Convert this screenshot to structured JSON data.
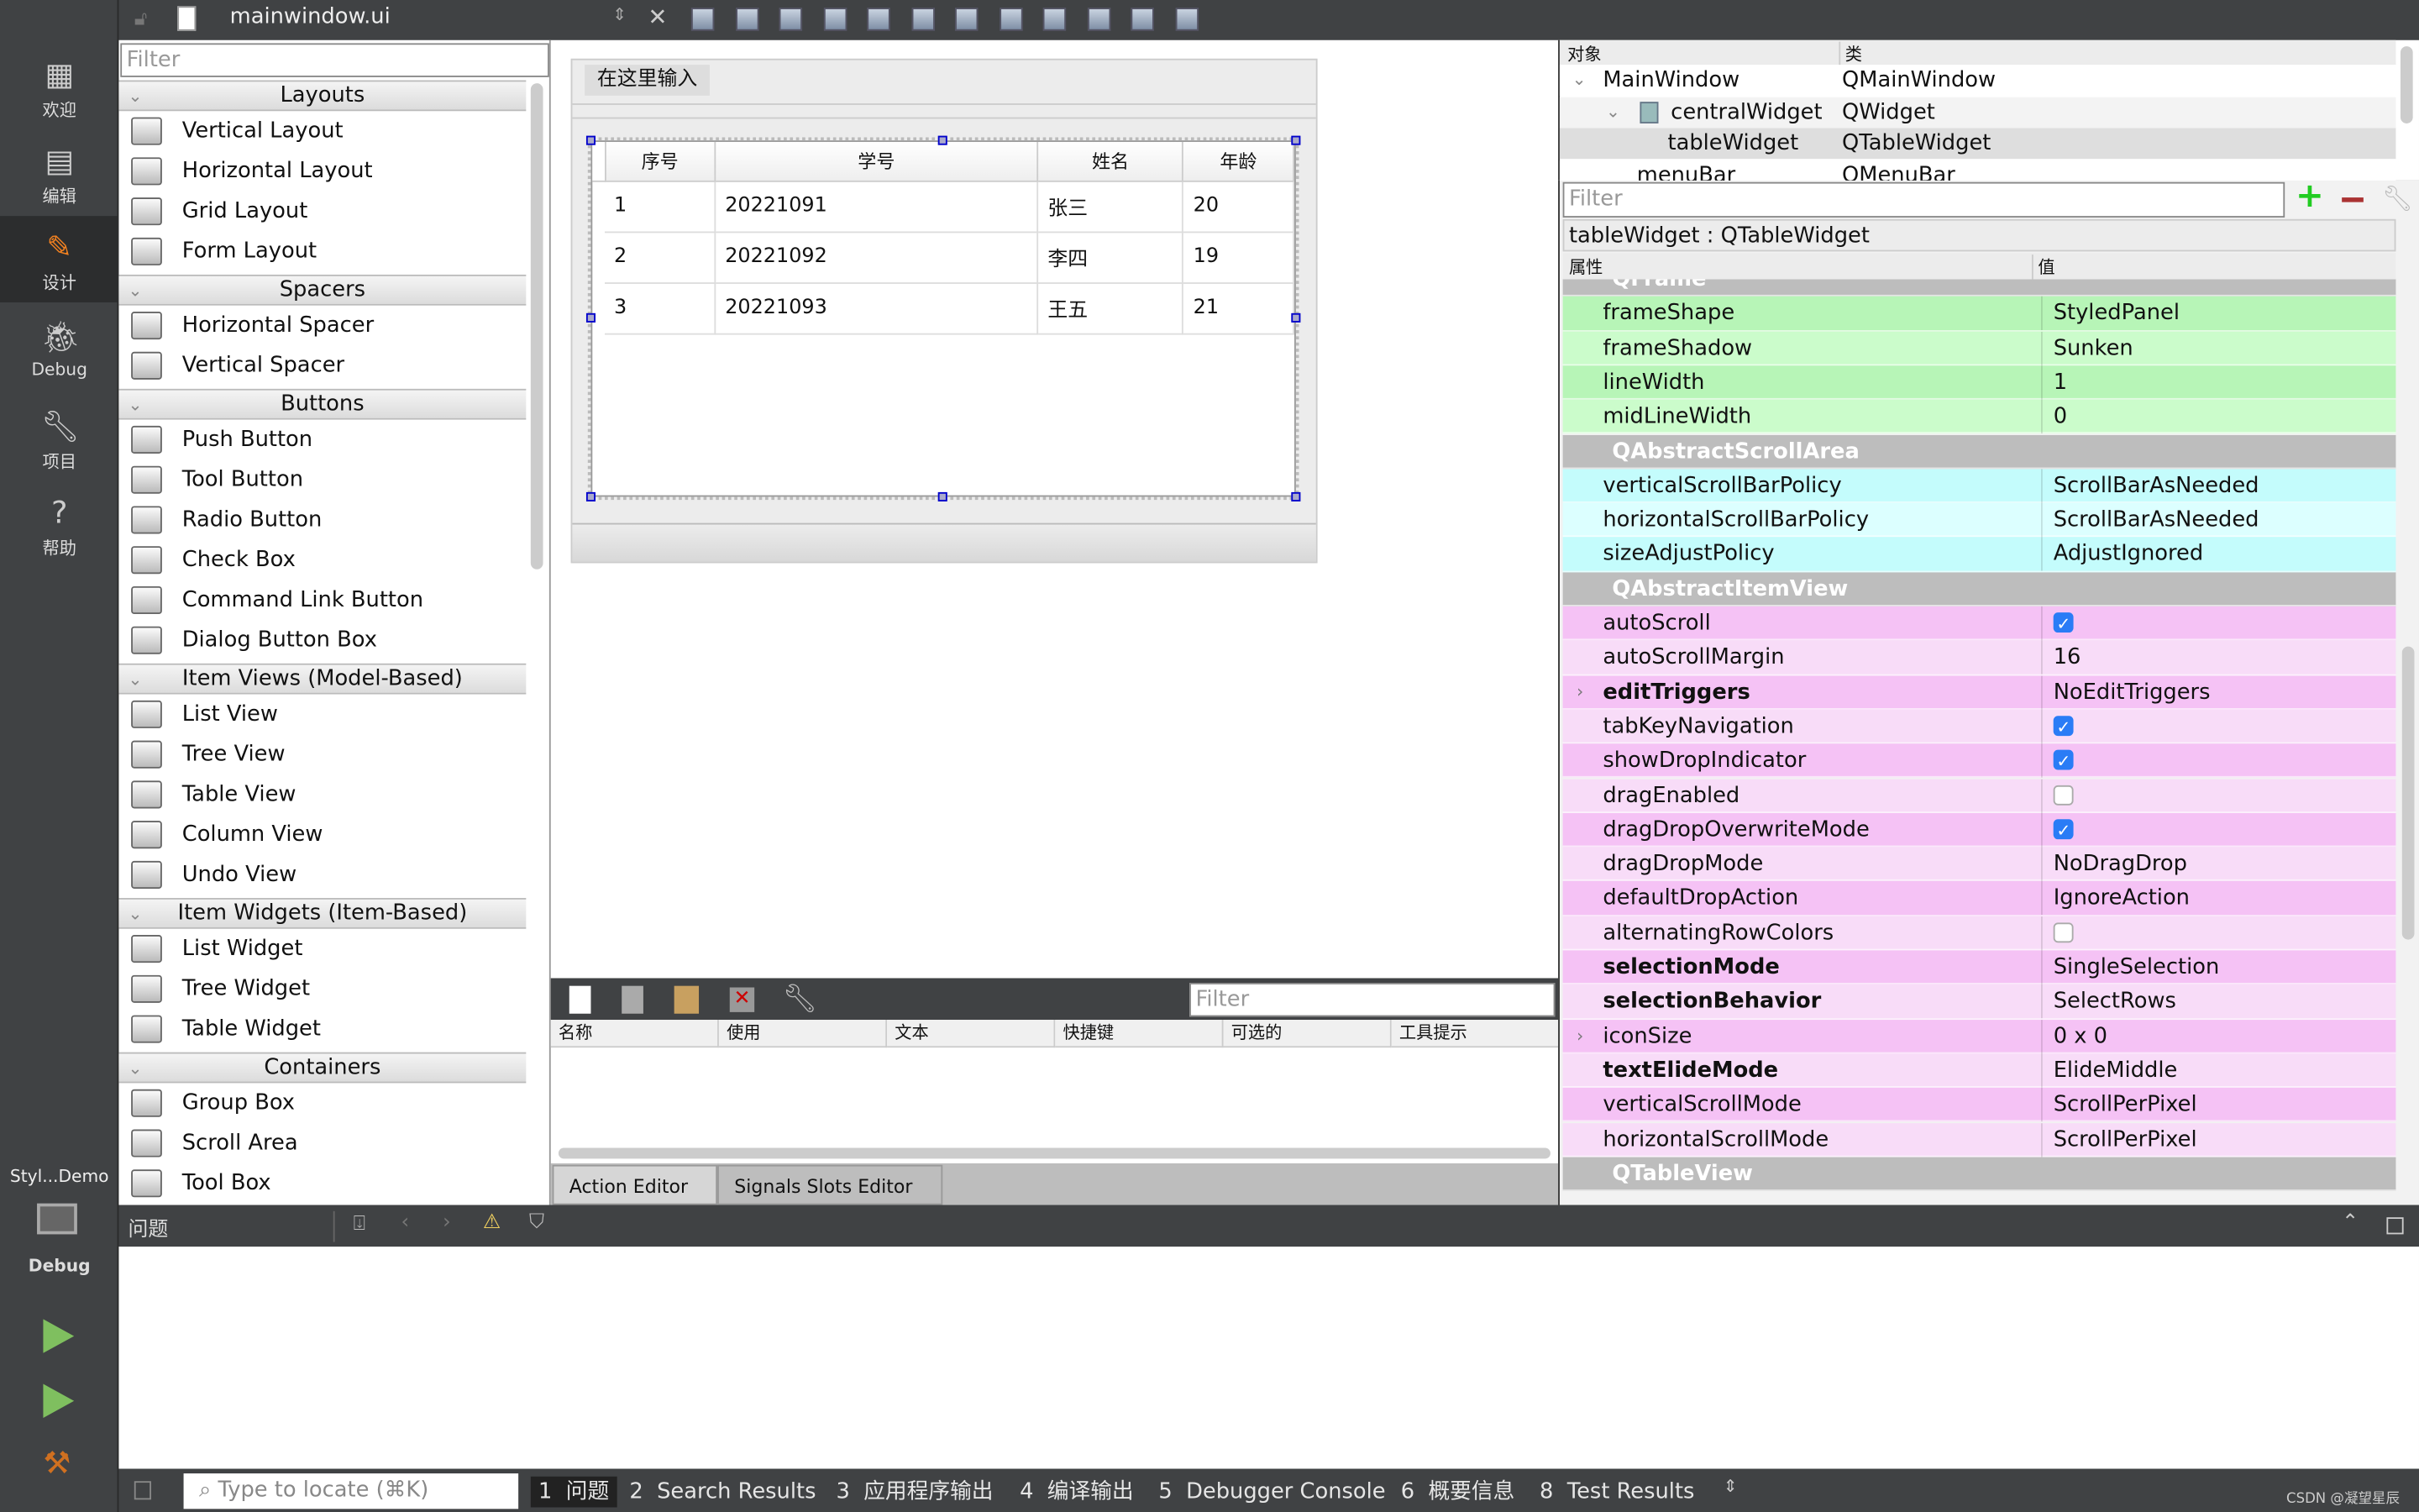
{
  "modebar": {
    "items": [
      {
        "label": "欢迎",
        "icon": "grid-icon"
      },
      {
        "label": "编辑",
        "icon": "document-icon"
      },
      {
        "label": "设计",
        "icon": "pencil-icon",
        "active": true
      },
      {
        "label": "Debug",
        "icon": "bug-icon"
      },
      {
        "label": "项目",
        "icon": "wrench-icon"
      },
      {
        "label": "帮助",
        "icon": "help-icon"
      }
    ],
    "project": "Styl...Demo",
    "kit_label": "Debug"
  },
  "topbar": {
    "filename": "mainwindow.ui"
  },
  "widgetbox": {
    "filter_placeholder": "Filter",
    "sections": [
      {
        "title": "Layouts",
        "items": [
          "Vertical Layout",
          "Horizontal Layout",
          "Grid Layout",
          "Form Layout"
        ]
      },
      {
        "title": "Spacers",
        "items": [
          "Horizontal Spacer",
          "Vertical Spacer"
        ]
      },
      {
        "title": "Buttons",
        "items": [
          "Push Button",
          "Tool Button",
          "Radio Button",
          "Check Box",
          "Command Link Button",
          "Dialog Button Box"
        ]
      },
      {
        "title": "Item Views (Model-Based)",
        "items": [
          "List View",
          "Tree View",
          "Table View",
          "Column View",
          "Undo View"
        ]
      },
      {
        "title": "Item Widgets (Item-Based)",
        "items": [
          "List Widget",
          "Tree Widget",
          "Table Widget"
        ]
      },
      {
        "title": "Containers",
        "items": [
          "Group Box",
          "Scroll Area",
          "Tool Box"
        ]
      }
    ]
  },
  "form": {
    "menu_placeholder": "在这里输入",
    "table": {
      "headers": [
        "序号",
        "学号",
        "姓名",
        "年龄"
      ],
      "rows": [
        [
          "1",
          "20221091",
          "张三",
          "20"
        ],
        [
          "2",
          "20221092",
          "李四",
          "19"
        ],
        [
          "3",
          "20221093",
          "王五",
          "21"
        ]
      ]
    }
  },
  "action_editor": {
    "filter_placeholder": "Filter",
    "columns": [
      "名称",
      "使用",
      "文本",
      "快捷键",
      "可选的",
      "工具提示"
    ],
    "tabs": [
      "Action Editor",
      "Signals  Slots Editor"
    ]
  },
  "object_inspector": {
    "headers": [
      "对象",
      "类"
    ],
    "rows": [
      [
        "MainWindow",
        "QMainWindow"
      ],
      [
        "centralWidget",
        "QWidget"
      ],
      [
        "tableWidget",
        "QTableWidget"
      ],
      [
        "menuBar",
        "QMenuBar"
      ]
    ]
  },
  "property_editor": {
    "filter_placeholder": "Filter",
    "object_label": "tableWidget : QTableWidget",
    "headers": [
      "属性",
      "值"
    ],
    "group_colors": {
      "QFrame": [
        "#b7f5b7",
        "#cbfccb"
      ],
      "QAbstractScrollArea": [
        "#c4fcfc",
        "#dcffff"
      ],
      "QAbstractItemView": [
        "#f5c2f5",
        "#f8dcf8"
      ],
      "QTableView": [
        "#ffbff0",
        "#ffd6f4"
      ]
    },
    "rows": [
      {
        "group": "QFrame"
      },
      {
        "name": "frameShape",
        "value": "StyledPanel",
        "g": "QFrame"
      },
      {
        "name": "frameShadow",
        "value": "Sunken",
        "g": "QFrame"
      },
      {
        "name": "lineWidth",
        "value": "1",
        "g": "QFrame"
      },
      {
        "name": "midLineWidth",
        "value": "0",
        "g": "QFrame"
      },
      {
        "group": "QAbstractScrollArea"
      },
      {
        "name": "verticalScrollBarPolicy",
        "value": "ScrollBarAsNeeded",
        "g": "QAbstractScrollArea"
      },
      {
        "name": "horizontalScrollBarPolicy",
        "value": "ScrollBarAsNeeded",
        "g": "QAbstractScrollArea"
      },
      {
        "name": "sizeAdjustPolicy",
        "value": "AdjustIgnored",
        "g": "QAbstractScrollArea"
      },
      {
        "group": "QAbstractItemView"
      },
      {
        "name": "autoScroll",
        "check": true,
        "g": "QAbstractItemView"
      },
      {
        "name": "autoScrollMargin",
        "value": "16",
        "g": "QAbstractItemView"
      },
      {
        "name": "editTriggers",
        "value": "NoEditTriggers",
        "bold": true,
        "expand": true,
        "g": "QAbstractItemView"
      },
      {
        "name": "tabKeyNavigation",
        "check": true,
        "g": "QAbstractItemView"
      },
      {
        "name": "showDropIndicator",
        "check": true,
        "g": "QAbstractItemView"
      },
      {
        "name": "dragEnabled",
        "check": false,
        "g": "QAbstractItemView"
      },
      {
        "name": "dragDropOverwriteMode",
        "check": true,
        "g": "QAbstractItemView"
      },
      {
        "name": "dragDropMode",
        "value": "NoDragDrop",
        "g": "QAbstractItemView"
      },
      {
        "name": "defaultDropAction",
        "value": "IgnoreAction",
        "g": "QAbstractItemView"
      },
      {
        "name": "alternatingRowColors",
        "check": false,
        "g": "QAbstractItemView"
      },
      {
        "name": "selectionMode",
        "value": "SingleSelection",
        "bold": true,
        "g": "QAbstractItemView"
      },
      {
        "name": "selectionBehavior",
        "value": "SelectRows",
        "bold": true,
        "g": "QAbstractItemView"
      },
      {
        "name": "iconSize",
        "value": "0 x 0",
        "expand": true,
        "g": "QAbstractItemView"
      },
      {
        "name": "textElideMode",
        "value": "ElideMiddle",
        "bold": true,
        "g": "QAbstractItemView"
      },
      {
        "name": "verticalScrollMode",
        "value": "ScrollPerPixel",
        "g": "QAbstractItemView"
      },
      {
        "name": "horizontalScrollMode",
        "value": "ScrollPerPixel",
        "g": "QAbstractItemView"
      },
      {
        "group": "QTableView"
      }
    ]
  },
  "output": {
    "title": "问题"
  },
  "statusbar": {
    "locate_placeholder": "Type to locate (⌘K)",
    "tabs": [
      "1  问题",
      "2  Search Results",
      "3  应用程序输出",
      "4  编译输出",
      "5  Debugger Console",
      "6  概要信息",
      "8  Test Results"
    ],
    "watermark": "CSDN @凝望星辰"
  }
}
